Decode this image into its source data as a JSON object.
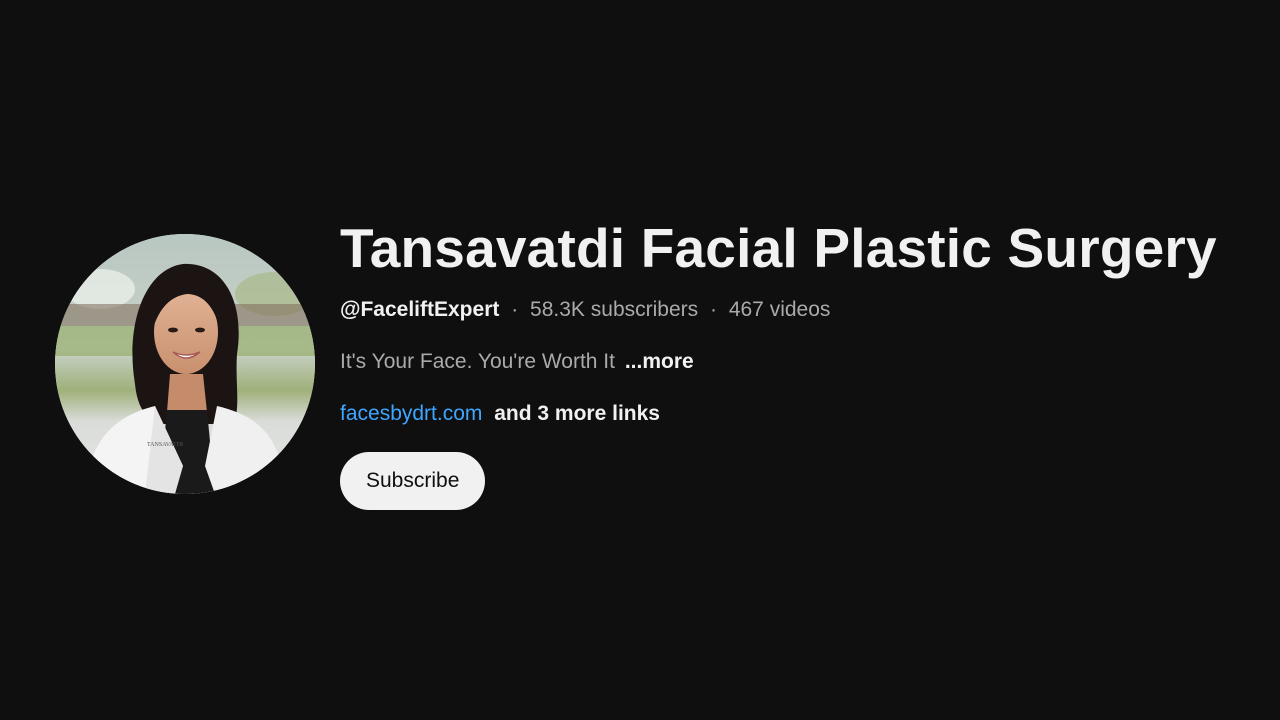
{
  "channel": {
    "title": "Tansavatdi Facial Plastic Surgery",
    "handle": "@FaceliftExpert",
    "separator": "·",
    "subscribers": "58.3K subscribers",
    "videos": "467 videos",
    "description": "It's Your Face. You're Worth It",
    "description_more": "...more",
    "link": "facesbydrt.com",
    "more_links": "and 3 more links",
    "subscribe_label": "Subscribe"
  },
  "colors": {
    "background": "#0f0f0f",
    "primary_text": "#f1f1f1",
    "secondary_text": "#aaaaaa",
    "link": "#3ea6ff",
    "button_bg": "#f1f1f1",
    "button_text": "#0f0f0f"
  }
}
